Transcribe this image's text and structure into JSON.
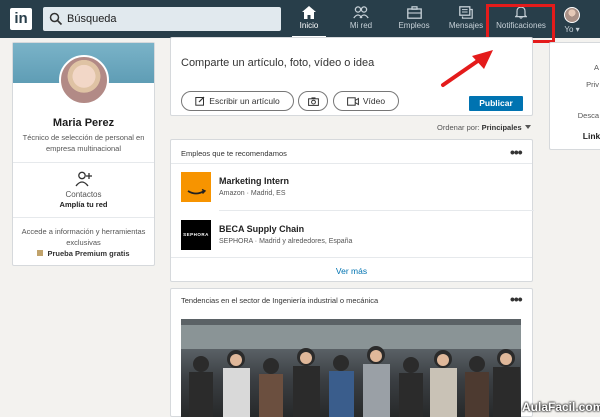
{
  "nav": {
    "logo": "in",
    "search_placeholder": "Búsqueda",
    "items": [
      {
        "label": "Inicio",
        "icon": "home-icon",
        "active": true
      },
      {
        "label": "Mi red",
        "icon": "network-icon",
        "active": false
      },
      {
        "label": "Empleos",
        "icon": "briefcase-icon",
        "active": false
      },
      {
        "label": "Mensajes",
        "icon": "messages-icon",
        "active": false
      },
      {
        "label": "Notificaciones",
        "icon": "bell-icon",
        "active": false
      },
      {
        "label": "Yo",
        "icon": "avatar",
        "active": false
      }
    ],
    "highlight_color": "#e41b1b"
  },
  "profile": {
    "name": "Maria Perez",
    "title": "Técnico de selección de personal en empresa multinacional",
    "contacts_label": "Contactos",
    "contacts_sub": "Amplía tu red",
    "premium_text": "Accede a información y herramientas exclusivas",
    "premium_link": "Prueba Premium gratis"
  },
  "share": {
    "placeholder": "Comparte un artículo, foto, vídeo o idea",
    "write_article": "Escribir un artículo",
    "video": "Vídeo",
    "publish": "Publicar"
  },
  "sort": {
    "label": "Ordenar por:",
    "value": "Principales"
  },
  "jobs": {
    "header": "Empleos que te recomendamos",
    "items": [
      {
        "title": "Marketing Intern",
        "subtitle": "Amazon · Madrid, ES",
        "logo": "amazon"
      },
      {
        "title": "BECA Supply Chain",
        "subtitle": "SEPHORA · Madrid y alrededores, España",
        "logo": "SEPHORA"
      }
    ],
    "more": "Ver más"
  },
  "trends": {
    "header": "Tendencias en el sector de Ingeniería industrial o mecánica"
  },
  "right_panel": {
    "items": [
      "A",
      "Priv",
      "Desca",
      "Linke"
    ]
  },
  "watermark": "AulaFacil.com",
  "colors": {
    "nav_bg": "#283e4a",
    "accent": "#0073b1",
    "highlight": "#e41b1b"
  }
}
